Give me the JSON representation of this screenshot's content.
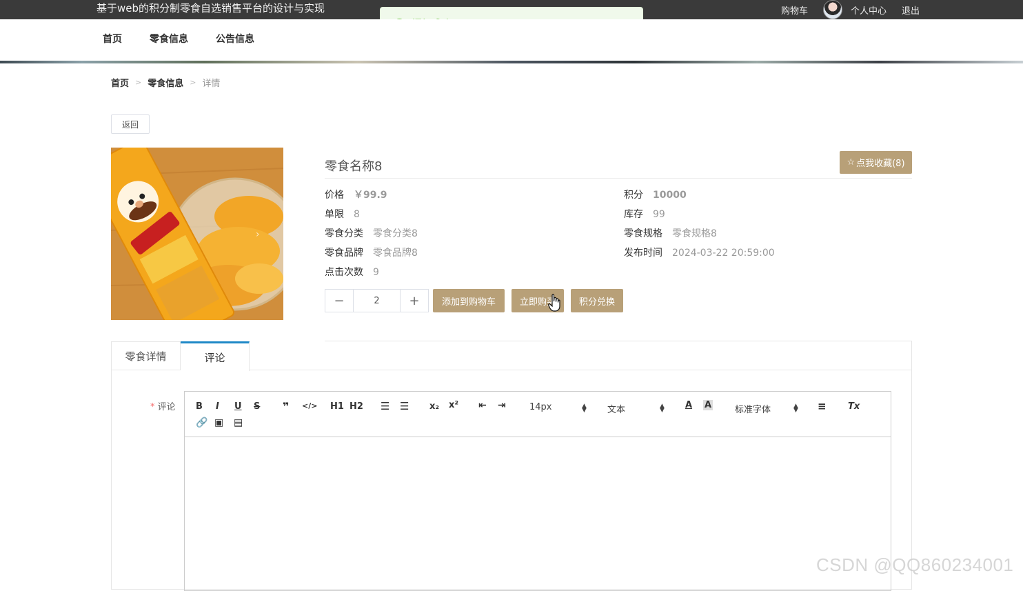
{
  "header": {
    "site_title": "基于web的积分制零食自选销售平台的设计与实现",
    "cart": "购物车",
    "profile": "个人中心",
    "logout": "退出"
  },
  "toast": {
    "message": "添加成功",
    "icon": "check-circle-icon",
    "color": "#67c23a"
  },
  "nav": {
    "home": "首页",
    "snacks": "零食信息",
    "notice": "公告信息"
  },
  "breadcrumb": {
    "home": "首页",
    "category": "零食信息",
    "current": "详情",
    "separator": ">"
  },
  "back_label": "返回",
  "product": {
    "name": "零食名称8",
    "favorite_label": "点我收藏(8)",
    "image_arrow": "›",
    "attributes": {
      "price": {
        "label": "价格",
        "value": "￥99.9"
      },
      "points": {
        "label": "积分",
        "value": "10000"
      },
      "limit": {
        "label": "单限",
        "value": "8"
      },
      "stock": {
        "label": "库存",
        "value": "99"
      },
      "category": {
        "label": "零食分类",
        "value": "零食分类8"
      },
      "spec": {
        "label": "零食规格",
        "value": "零食规格8"
      },
      "brand": {
        "label": "零食品牌",
        "value": "零食品牌8"
      },
      "publish_time": {
        "label": "发布时间",
        "value": "2024-03-22 20:59:00"
      },
      "clicks": {
        "label": "点击次数",
        "value": "9"
      }
    },
    "quantity": "2",
    "actions": {
      "add_to_cart": "添加到购物车",
      "buy_now": "立即购买",
      "redeem": "积分兑换"
    }
  },
  "tabs": [
    {
      "label": "零食详情"
    },
    {
      "label": "评论"
    }
  ],
  "comment": {
    "required_mark": "*",
    "label": "评论",
    "toolbar": {
      "bold": "B",
      "italic": "I",
      "underline": "U",
      "strike": "S",
      "h1": "H1",
      "h2": "H2",
      "sub": "x₂",
      "sup": "x²",
      "size": "14px",
      "header": "文本",
      "font": "标准字体",
      "clean": "Tx"
    }
  },
  "accent_color": "#b8a078",
  "watermark": "CSDN @QQ860234001"
}
